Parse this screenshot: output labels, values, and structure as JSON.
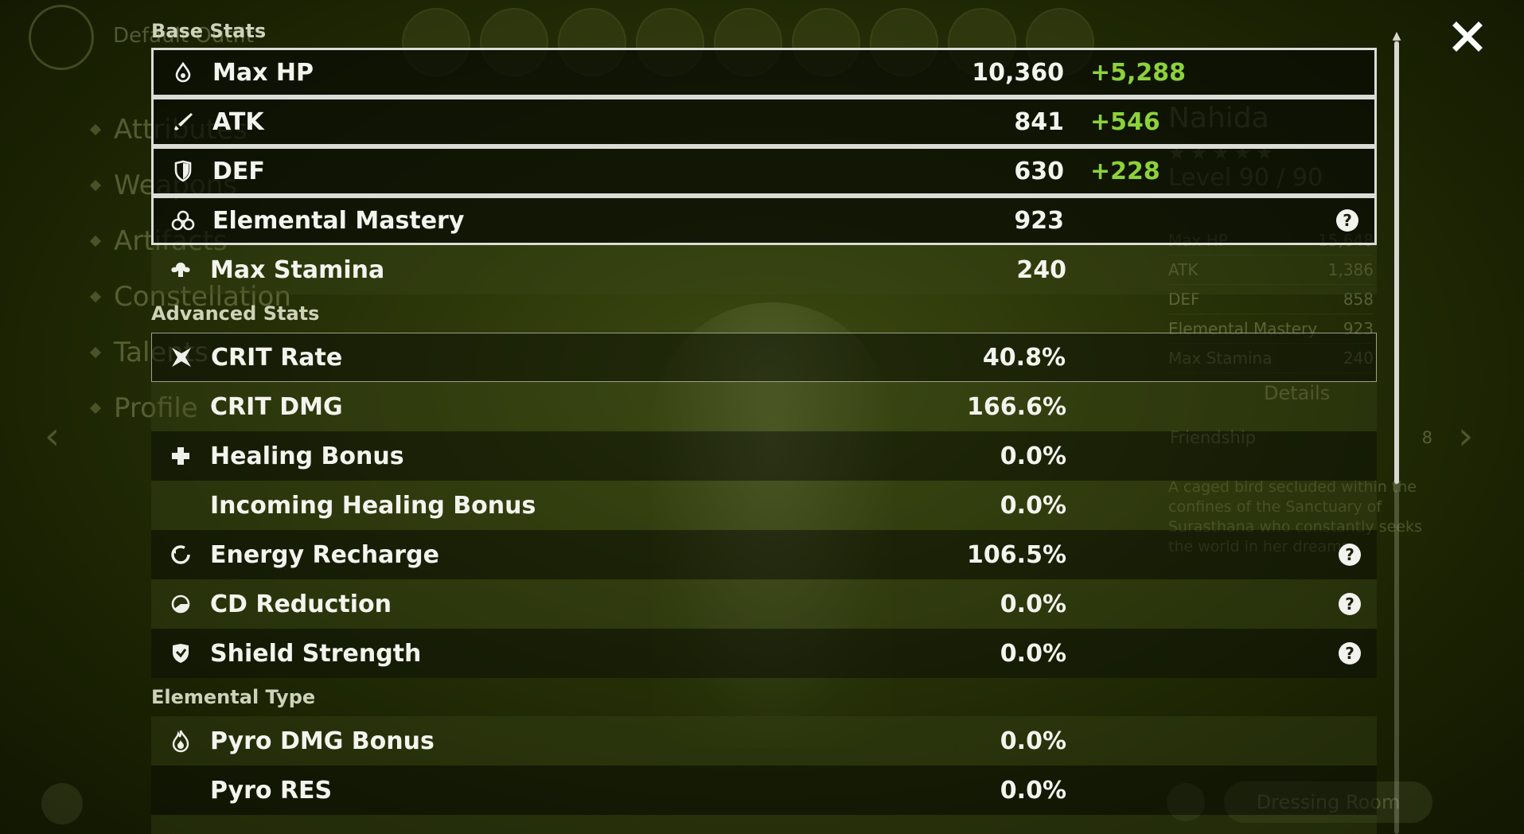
{
  "background": {
    "section_title": "Default Outfit",
    "menu": [
      "Attributes",
      "Weapons",
      "Artifacts",
      "Constellation",
      "Talents",
      "Profile"
    ],
    "character": {
      "name": "Nahida",
      "stars": "★★★★★",
      "level": "Level 90 / 90",
      "stats": [
        {
          "label": "Max HP",
          "value": "15,648"
        },
        {
          "label": "ATK",
          "value": "1,386"
        },
        {
          "label": "DEF",
          "value": "858"
        },
        {
          "label": "Elemental Mastery",
          "value": "923"
        },
        {
          "label": "Max Stamina",
          "value": "240"
        }
      ],
      "details_label": "Details",
      "friendship_label": "Friendship",
      "friendship_level": "8",
      "description": "A caged bird secluded within the confines of the Sanctuary of Surasthana who constantly seeks the world in her dreams."
    },
    "dressing_room_label": "Dressing Room"
  },
  "panel": {
    "base_title": "Base Stats",
    "advanced_title": "Advanced Stats",
    "elemental_title": "Elemental Type",
    "base_stats": [
      {
        "name": "Max HP",
        "value": "10,360",
        "bonus": "+5,288",
        "icon": "hp-drop-icon"
      },
      {
        "name": "ATK",
        "value": "841",
        "bonus": "+546",
        "icon": "sword-icon"
      },
      {
        "name": "DEF",
        "value": "630",
        "bonus": "+228",
        "icon": "shield-icon"
      },
      {
        "name": "Elemental Mastery",
        "value": "923",
        "bonus": "",
        "icon": "mastery-icon"
      },
      {
        "name": "Max Stamina",
        "value": "240",
        "bonus": "",
        "icon": "stamina-icon"
      }
    ],
    "advanced_stats": [
      {
        "name": "CRIT Rate",
        "value": "40.8%",
        "icon": "crit-icon"
      },
      {
        "name": "CRIT DMG",
        "value": "166.6%",
        "icon": ""
      },
      {
        "name": "Healing Bonus",
        "value": "0.0%",
        "icon": "cross-icon"
      },
      {
        "name": "Incoming Healing Bonus",
        "value": "0.0%",
        "icon": ""
      },
      {
        "name": "Energy Recharge",
        "value": "106.5%",
        "icon": "energy-icon"
      },
      {
        "name": "CD Reduction",
        "value": "0.0%",
        "icon": "cd-icon"
      },
      {
        "name": "Shield Strength",
        "value": "0.0%",
        "icon": "shield-strength-icon"
      }
    ],
    "elemental_stats": [
      {
        "name": "Pyro DMG Bonus",
        "value": "0.0%",
        "icon": "pyro-icon"
      },
      {
        "name": "Pyro RES",
        "value": "0.0%",
        "icon": ""
      }
    ],
    "help_symbol": "?"
  },
  "colors": {
    "bonus_green": "#8cd23a",
    "text_white": "#f4f4ee",
    "highlight_border": "#dcdcd6"
  }
}
